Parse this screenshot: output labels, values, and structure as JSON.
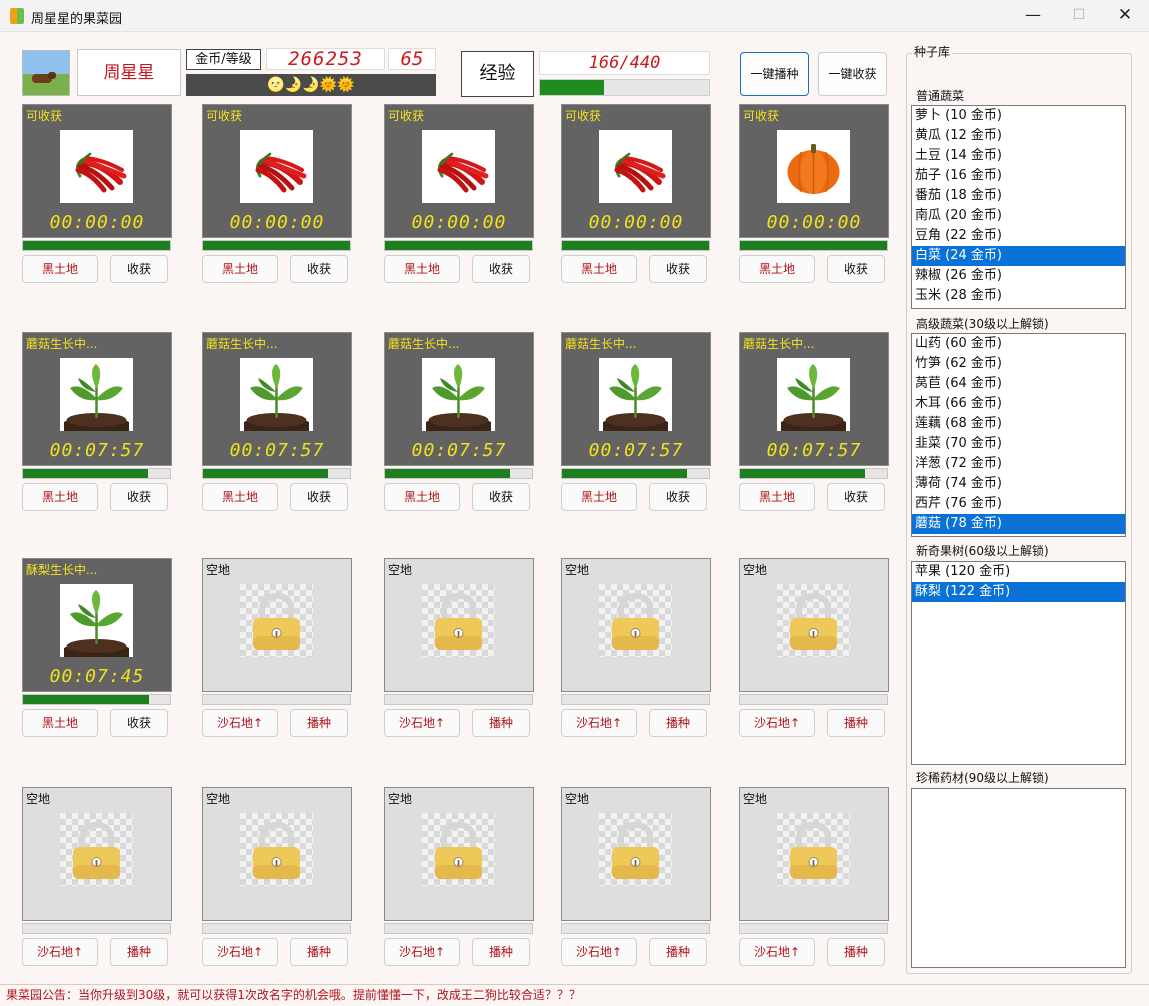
{
  "window": {
    "title": "周星星的果菜园"
  },
  "player": {
    "name": "周星星",
    "coin_level_label": "金币/等级",
    "coins": "266253",
    "level": "65",
    "weather": "🌝🌛🌛🌞🌞",
    "exp_label": "经验",
    "exp_text": "166/440",
    "exp_progress": 0.377
  },
  "actions": {
    "plant_all": "一键播种",
    "harvest_all": "一键收获"
  },
  "plots": [
    {
      "state": "grown",
      "status": "可收获",
      "crop": "chili",
      "timer": "00:00:00",
      "progress": 1.0,
      "soil": "黑土地",
      "action": "收获"
    },
    {
      "state": "grown",
      "status": "可收获",
      "crop": "chili",
      "timer": "00:00:00",
      "progress": 1.0,
      "soil": "黑土地",
      "action": "收获"
    },
    {
      "state": "grown",
      "status": "可收获",
      "crop": "chili",
      "timer": "00:00:00",
      "progress": 1.0,
      "soil": "黑土地",
      "action": "收获"
    },
    {
      "state": "grown",
      "status": "可收获",
      "crop": "chili",
      "timer": "00:00:00",
      "progress": 1.0,
      "soil": "黑土地",
      "action": "收获"
    },
    {
      "state": "grown",
      "status": "可收获",
      "crop": "pumpkin",
      "timer": "00:00:00",
      "progress": 1.0,
      "soil": "黑土地",
      "action": "收获"
    },
    {
      "state": "grown",
      "status": "蘑菇生长中...",
      "crop": "sprout",
      "timer": "00:07:57",
      "progress": 0.85,
      "soil": "黑土地",
      "action": "收获"
    },
    {
      "state": "grown",
      "status": "蘑菇生长中...",
      "crop": "sprout",
      "timer": "00:07:57",
      "progress": 0.85,
      "soil": "黑土地",
      "action": "收获"
    },
    {
      "state": "grown",
      "status": "蘑菇生长中...",
      "crop": "sprout",
      "timer": "00:07:57",
      "progress": 0.85,
      "soil": "黑土地",
      "action": "收获"
    },
    {
      "state": "grown",
      "status": "蘑菇生长中...",
      "crop": "sprout",
      "timer": "00:07:57",
      "progress": 0.85,
      "soil": "黑土地",
      "action": "收获"
    },
    {
      "state": "grown",
      "status": "蘑菇生长中...",
      "crop": "sprout",
      "timer": "00:07:57",
      "progress": 0.85,
      "soil": "黑土地",
      "action": "收获"
    },
    {
      "state": "grown",
      "status": "酥梨生长中...",
      "crop": "sprout",
      "timer": "00:07:45",
      "progress": 0.86,
      "soil": "黑土地",
      "action": "收获"
    },
    {
      "state": "empty",
      "status": "空地",
      "crop": "lock",
      "timer": "",
      "progress": 0,
      "soil": "沙石地↑",
      "action": "播种"
    },
    {
      "state": "empty",
      "status": "空地",
      "crop": "lock",
      "timer": "",
      "progress": 0,
      "soil": "沙石地↑",
      "action": "播种"
    },
    {
      "state": "empty",
      "status": "空地",
      "crop": "lock",
      "timer": "",
      "progress": 0,
      "soil": "沙石地↑",
      "action": "播种"
    },
    {
      "state": "empty",
      "status": "空地",
      "crop": "lock",
      "timer": "",
      "progress": 0,
      "soil": "沙石地↑",
      "action": "播种"
    },
    {
      "state": "empty",
      "status": "空地",
      "crop": "lock",
      "timer": "",
      "progress": 0,
      "soil": "沙石地↑",
      "action": "播种"
    },
    {
      "state": "empty",
      "status": "空地",
      "crop": "lock",
      "timer": "",
      "progress": 0,
      "soil": "沙石地↑",
      "action": "播种"
    },
    {
      "state": "empty",
      "status": "空地",
      "crop": "lock",
      "timer": "",
      "progress": 0,
      "soil": "沙石地↑",
      "action": "播种"
    },
    {
      "state": "empty",
      "status": "空地",
      "crop": "lock",
      "timer": "",
      "progress": 0,
      "soil": "沙石地↑",
      "action": "播种"
    },
    {
      "state": "empty",
      "status": "空地",
      "crop": "lock",
      "timer": "",
      "progress": 0,
      "soil": "沙石地↑",
      "action": "播种"
    }
  ],
  "seed_library": {
    "title": "种子库",
    "categories": [
      {
        "label": "普通蔬菜",
        "selected": 7,
        "items": [
          "萝卜 (10 金币)",
          "黄瓜 (12 金币)",
          "土豆 (14 金币)",
          "茄子 (16 金币)",
          "番茄 (18 金币)",
          "南瓜 (20 金币)",
          "豆角 (22 金币)",
          "白菜 (24 金币)",
          "辣椒 (26 金币)",
          "玉米 (28 金币)"
        ]
      },
      {
        "label": "高级蔬菜(30级以上解锁)",
        "selected": 9,
        "items": [
          "山药 (60 金币)",
          "竹笋 (62 金币)",
          "莴苣 (64 金币)",
          "木耳 (66 金币)",
          "莲藕 (68 金币)",
          "韭菜 (70 金币)",
          "洋葱 (72 金币)",
          "薄荷 (74 金币)",
          "西芹 (76 金币)",
          "蘑菇 (78 金币)"
        ]
      },
      {
        "label": "新奇果树(60级以上解锁)",
        "selected": 1,
        "items": [
          "苹果 (120 金币)",
          "酥梨 (122 金币)"
        ]
      },
      {
        "label": "珍稀药材(90级以上解锁)",
        "selected": -1,
        "items": []
      }
    ]
  },
  "notice": "果菜园公告：当你升级到30级，就可以获得1次改名字的机会哦。提前懂懂一下，改成王二狗比较合适？？？"
}
